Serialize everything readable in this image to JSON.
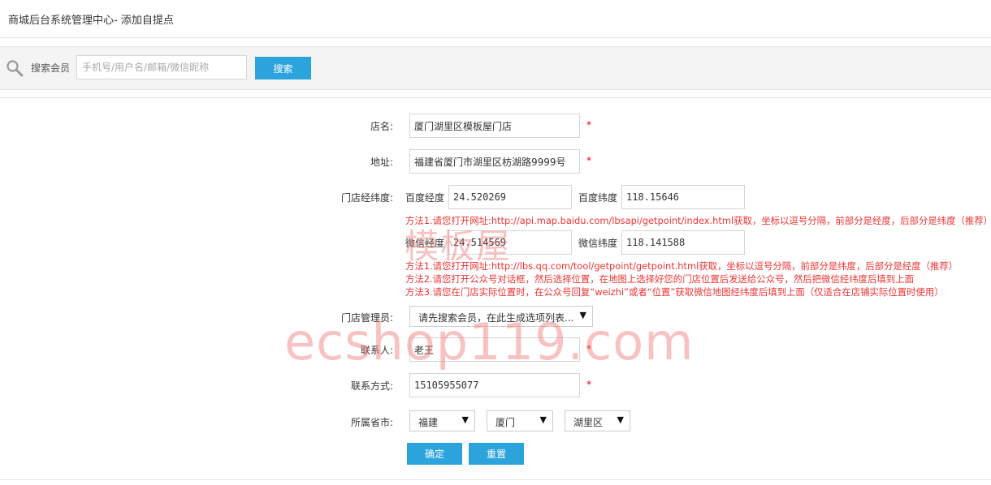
{
  "header": {
    "title": "商城后台系统管理中心- 添加自提点"
  },
  "search": {
    "label": "搜索会员",
    "placeholder": "手机号/用户名/邮箱/微信昵称",
    "button": "搜索",
    "icon": "search-icon"
  },
  "form": {
    "store_name": {
      "label": "店名:",
      "value": "厦门湖里区模板屋门店",
      "required": "*"
    },
    "address": {
      "label": "地址:",
      "value": "福建省厦门市湖里区枋湖路9999号",
      "required": "*"
    },
    "coords": {
      "label": "门店经纬度:",
      "baidu_lng_label": "百度经度",
      "baidu_lng": "24.520269",
      "baidu_lat_label": "百度纬度",
      "baidu_lat": "118.15646",
      "hint_baidu": "方法1.请您打开网址:http://api.map.baidu.com/lbsapi/getpoint/index.html获取，坐标以逗号分隔，前部分是经度，后部分是纬度（推荐）",
      "wechat_lng_label": "微信经度",
      "wechat_lng": "24.514569",
      "wechat_lat_label": "微信纬度",
      "wechat_lat": "118.141588",
      "hint_wechat_1": "方法1.请您打开网址:http://lbs.qq.com/tool/getpoint/getpoint.html获取，坐标以逗号分隔，前部分是纬度，后部分是经度（推荐）",
      "hint_wechat_2": "方法2.请您打开公众号对话框，然后选择位置，在地图上选择好您的门店位置后发送给公众号，然后把微信经纬度后填到上面",
      "hint_wechat_3": "方法3.请您在门店实际位置时，在公众号回复“weizhi”或者“位置”获取微信地图经纬度后填到上面（仅适合在店铺实际位置时使用）"
    },
    "manager": {
      "label": "门店管理员:",
      "value": "请先搜索会员，在此生成选项列表..."
    },
    "contact": {
      "label": "联系人:",
      "value": "老王",
      "required": "*"
    },
    "phone": {
      "label": "联系方式:",
      "value": "15105955077",
      "required": "*"
    },
    "region": {
      "label": "所属省市:",
      "province": "福建",
      "city": "厦门",
      "district": "湖里区"
    },
    "submit": "确定",
    "reset": "重置"
  },
  "watermark": {
    "line1": "模板屋",
    "line2": "ecshop119.com"
  }
}
